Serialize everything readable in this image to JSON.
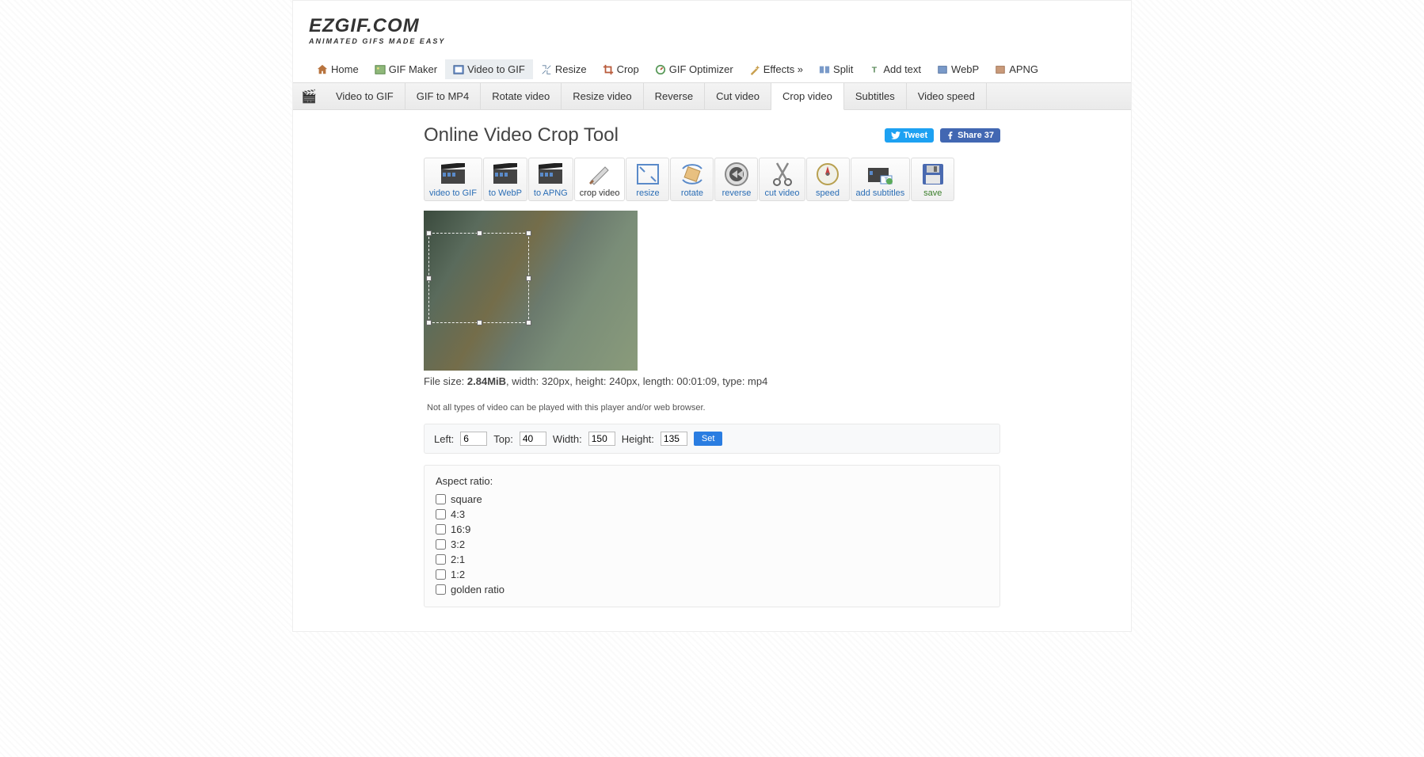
{
  "logo": {
    "title": "EZGIF.COM",
    "subtitle": "ANIMATED GIFS MADE EASY"
  },
  "mainNav": {
    "home": "Home",
    "gifMaker": "GIF Maker",
    "videoToGif": "Video to GIF",
    "resize": "Resize",
    "crop": "Crop",
    "optimizer": "GIF Optimizer",
    "effects": "Effects »",
    "split": "Split",
    "addText": "Add text",
    "webp": "WebP",
    "apng": "APNG"
  },
  "subNav": {
    "videoToGif": "Video to GIF",
    "gifToMp4": "GIF to MP4",
    "rotate": "Rotate video",
    "resizeVideo": "Resize video",
    "reverse": "Reverse",
    "cutVideo": "Cut video",
    "cropVideo": "Crop video",
    "subtitles": "Subtitles",
    "speed": "Video speed"
  },
  "pageTitle": "Online Video Crop Tool",
  "social": {
    "tweet": "Tweet",
    "share": "Share 37"
  },
  "tools": {
    "videoToGif": "video to GIF",
    "toWebP": "to WebP",
    "toAPNG": "to APNG",
    "cropVideo": "crop video",
    "resize": "resize",
    "rotate": "rotate",
    "reverse": "reverse",
    "cutVideo": "cut video",
    "speed": "speed",
    "addSubtitles": "add subtitles",
    "save": "save"
  },
  "fileInfo": {
    "prefix": "File size: ",
    "size": "2.84MiB",
    "rest": ", width: 320px, height: 240px, length: 00:01:09, type: mp4"
  },
  "disclaimer": "Not all types of video can be played with this player and/or web browser.",
  "cropControls": {
    "leftLabel": "Left:",
    "leftVal": "6",
    "topLabel": "Top:",
    "topVal": "40",
    "widthLabel": "Width:",
    "widthVal": "150",
    "heightLabel": "Height:",
    "heightVal": "135",
    "setBtn": "Set"
  },
  "aspect": {
    "title": "Aspect ratio:",
    "square": "square",
    "r43": "4:3",
    "r169": "16:9",
    "r32": "3:2",
    "r21": "2:1",
    "r12": "1:2",
    "golden": "golden ratio"
  }
}
